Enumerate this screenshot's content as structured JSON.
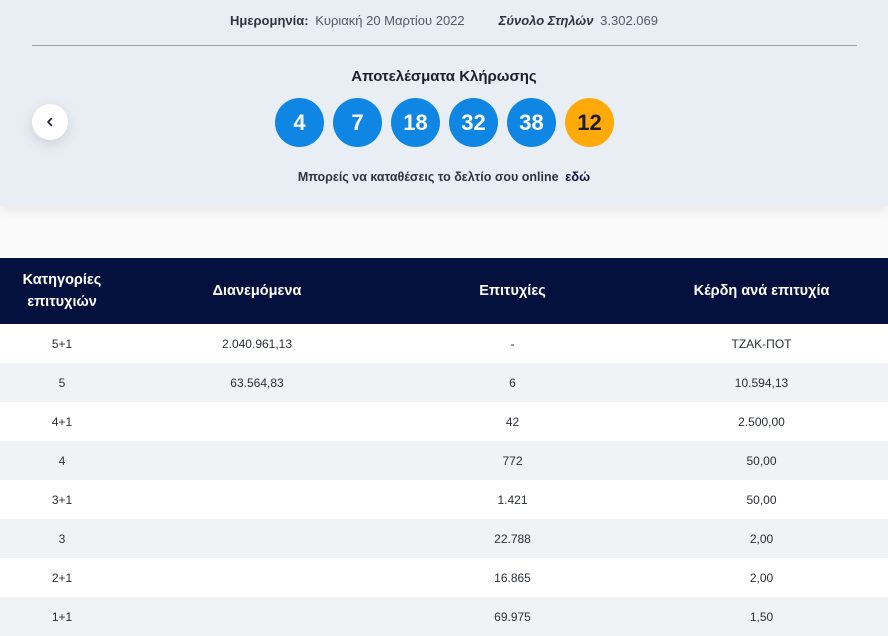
{
  "header": {
    "date_label": "Ημερομηνία:",
    "date_value": "Κυριακή 20 Μαρτίου 2022",
    "columns_label": "Σύνολο Στηλών",
    "columns_value": "3.302.069"
  },
  "draw": {
    "title": "Αποτελέσματα Κλήρωσης",
    "numbers": [
      "4",
      "7",
      "18",
      "32",
      "38"
    ],
    "joker": "12",
    "online_text": "Μπορείς να καταθέσεις το δελτίο σου online",
    "online_link": "εδώ"
  },
  "table": {
    "headers": {
      "category": "Κατηγορίες επιτυχιών",
      "distributed": "Διανεμόμενα",
      "winners": "Επιτυχίες",
      "prize": "Κέρδη ανά επιτυχία"
    },
    "rows": [
      {
        "category": "5+1",
        "distributed": "2.040.961,13",
        "winners": "-",
        "prize": "ΤΖΑΚ-ΠΟΤ"
      },
      {
        "category": "5",
        "distributed": "63.564,83",
        "winners": "6",
        "prize": "10.594,13"
      },
      {
        "category": "4+1",
        "distributed": "",
        "winners": "42",
        "prize": "2.500,00"
      },
      {
        "category": "4",
        "distributed": "",
        "winners": "772",
        "prize": "50,00"
      },
      {
        "category": "3+1",
        "distributed": "",
        "winners": "1.421",
        "prize": "50,00"
      },
      {
        "category": "3",
        "distributed": "",
        "winners": "22.788",
        "prize": "2,00"
      },
      {
        "category": "2+1",
        "distributed": "",
        "winners": "16.865",
        "prize": "2,00"
      },
      {
        "category": "1+1",
        "distributed": "",
        "winners": "69.975",
        "prize": "1,50"
      }
    ]
  },
  "colors": {
    "ball": "#0f86e3",
    "joker_ball": "#ffaa0a",
    "table_header": "#04113f",
    "top_background": "#e9edf4"
  },
  "icons": {
    "prev": "chevron-left-icon"
  }
}
